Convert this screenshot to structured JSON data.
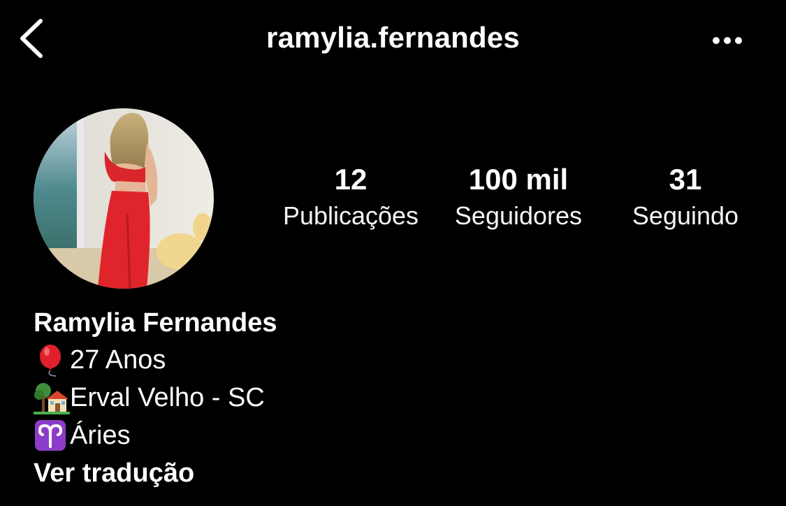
{
  "header": {
    "back_icon": "chevron-left-icon",
    "username": "ramylia.fernandes",
    "more_icon": "more-horizontal-icon"
  },
  "profile": {
    "avatar_description": "profile-photo"
  },
  "stats": {
    "posts_value": "12",
    "posts_label": "Publicações",
    "followers_value": "100 mil",
    "followers_label": "Seguidores",
    "following_value": "31",
    "following_label": "Seguindo"
  },
  "bio": {
    "full_name": "Ramylia Fernandes",
    "age_icon": "balloon-icon",
    "age_text": " 27 Anos",
    "location_icon": "house-with-garden-icon",
    "location_text": "Erval Velho - SC",
    "sign_icon": "aries-icon",
    "sign_text": " Áries",
    "translate_label": "Ver tradução"
  },
  "colors": {
    "background": "#000000",
    "text": "#ffffff",
    "balloon": "#e0202a",
    "aries_badge": "#8c3cc8"
  }
}
